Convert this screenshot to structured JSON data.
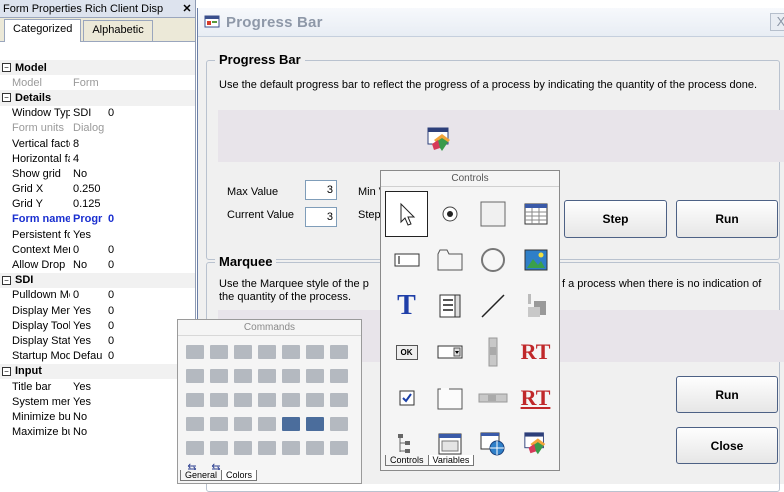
{
  "props_panel": {
    "title": "Form Properties Rich Client Disp",
    "close_glyph": "✕",
    "tabs": [
      "Categorized",
      "Alphabetic"
    ],
    "rows": [
      {
        "kind": "section",
        "label": "Model",
        "toggle": "⊟"
      },
      {
        "kind": "row",
        "key": "Model",
        "value": "Form",
        "extra": "",
        "style": "grey"
      },
      {
        "kind": "section",
        "label": "Details",
        "toggle": "⊟"
      },
      {
        "kind": "row",
        "key": "Window Type",
        "value": "SDI",
        "extra": "0",
        "style": ""
      },
      {
        "kind": "row",
        "key": "Form units",
        "value": "Dialog units",
        "extra": "",
        "style": "grey"
      },
      {
        "kind": "row",
        "key": "Vertical factor",
        "value": "8",
        "extra": "",
        "style": ""
      },
      {
        "kind": "row",
        "key": "Horizontal facto",
        "value": "4",
        "extra": "",
        "style": ""
      },
      {
        "kind": "row",
        "key": "Show grid",
        "value": "No",
        "extra": "",
        "style": ""
      },
      {
        "kind": "row",
        "key": "Grid X",
        "value": "0.250",
        "extra": "",
        "style": ""
      },
      {
        "kind": "row",
        "key": "Grid Y",
        "value": "0.125",
        "extra": "",
        "style": ""
      },
      {
        "kind": "row",
        "key": "Form name",
        "value": "Progr",
        "extra": "0",
        "style": "blue"
      },
      {
        "kind": "row",
        "key": "Persistent form s",
        "value": "Yes",
        "extra": "",
        "style": ""
      },
      {
        "kind": "row",
        "key": "Context Menu",
        "value": "0",
        "extra": "0",
        "style": ""
      },
      {
        "kind": "row",
        "key": "Allow Drop",
        "value": "No",
        "extra": "0",
        "style": ""
      },
      {
        "kind": "section",
        "label": "SDI",
        "toggle": "⊟"
      },
      {
        "kind": "row",
        "key": "Pulldown Menu",
        "value": "0",
        "extra": "0",
        "style": ""
      },
      {
        "kind": "row",
        "key": "Display Menu",
        "value": "Yes",
        "extra": "0",
        "style": ""
      },
      {
        "kind": "row",
        "key": "Display Toolbar",
        "value": "Yes",
        "extra": "0",
        "style": ""
      },
      {
        "kind": "row",
        "key": "Display Status E",
        "value": "Yes",
        "extra": "0",
        "style": ""
      },
      {
        "kind": "row",
        "key": "Startup Mode",
        "value": "Defau",
        "extra": "0",
        "style": ""
      },
      {
        "kind": "section",
        "label": "Input",
        "toggle": "⊟"
      },
      {
        "kind": "row",
        "key": "Title bar",
        "value": "Yes",
        "extra": "",
        "style": ""
      },
      {
        "kind": "row",
        "key": "System menu",
        "value": "Yes",
        "extra": "",
        "style": ""
      },
      {
        "kind": "row",
        "key": "Minimize button",
        "value": "No",
        "extra": "",
        "style": ""
      },
      {
        "kind": "row",
        "key": "Maximize buttor",
        "value": "No",
        "extra": "",
        "style": ""
      }
    ]
  },
  "window": {
    "title": "Progress Bar",
    "close_glyph": "X",
    "progress_group": {
      "legend": "Progress Bar",
      "description": "Use the default progress bar to reflect the progress of a process by indicating the quantity of the process done.",
      "max_label": "Max Value",
      "max_value": "3",
      "min_label": "Min V",
      "current_label": "Current Value",
      "current_value": "3",
      "step_label": "Step",
      "step_button": "Step",
      "run_button": "Run"
    },
    "marquee_group": {
      "legend": "Marquee",
      "description_left": "Use the Marquee style of the p",
      "description_right": "f a process when there is no indication of",
      "description_line2": "the quantity of the process.",
      "run_button": "Run"
    },
    "close_button": "Close"
  },
  "commands_palette": {
    "title": "Commands",
    "tabs": [
      "General",
      "Colors"
    ]
  },
  "controls_palette": {
    "title": "Controls",
    "tabs": [
      "Controls",
      "Variables"
    ],
    "tools": [
      "pointer-icon",
      "radio-button-icon",
      "static-box-icon",
      "table-icon",
      "edit-field-icon",
      "tab-control-icon",
      "ellipse-icon",
      "picture-icon",
      "text-label-icon",
      "list-box-icon",
      "line-icon",
      "image-button-icon",
      "ok-button-icon",
      "combo-box-icon",
      "vertical-scrollbar-icon",
      "rich-text-icon",
      "checkbox-icon",
      "group-box-icon",
      "horizontal-scrollbar-icon",
      "rich-text-field-icon",
      "tree-view-icon",
      "window-frame-icon",
      "web-browser-icon",
      "progress-bar-icon"
    ],
    "tool_glyphs": [
      "T",
      "RT",
      "OK"
    ]
  },
  "colors": {
    "accent_blue": "#1a2fd0",
    "window_bg": "#f0f0f0",
    "band": "#e8e4ea"
  }
}
